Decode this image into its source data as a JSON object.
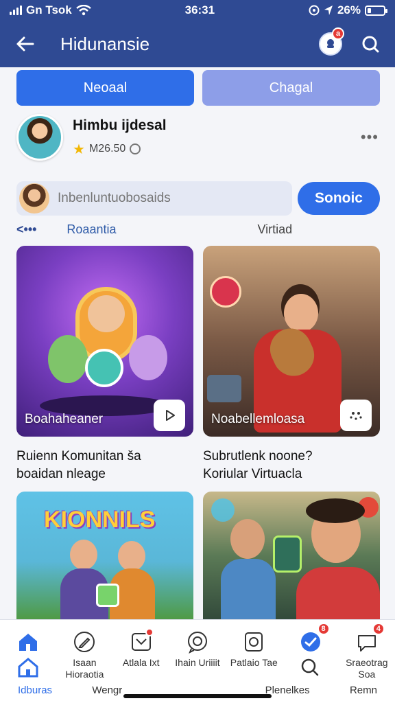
{
  "status": {
    "left_text": "Gn Tsok",
    "time": "36:31",
    "battery": "26%"
  },
  "header": {
    "title": "Hidunansie",
    "notification_count": "a"
  },
  "tabs": [
    {
      "label": "Neoaal"
    },
    {
      "label": "Chagal"
    }
  ],
  "profile": {
    "name": "Himbu ijdesal",
    "meta": "M26.50"
  },
  "composer": {
    "placeholder": "Inbenluntuobosaids",
    "send_label": "Sonoic"
  },
  "subnav": {
    "back": "<•••",
    "left": "Roaantia",
    "right": "Virtiad"
  },
  "cards": [
    {
      "caption": "Boahaheaner",
      "title_line1": "Ruienn Komunitan  ša",
      "title_line2": "boaidan nleage"
    },
    {
      "caption": "Noabellemloasa",
      "title_line1": "Subrutlenk noone?",
      "title_line2": "Koriular Virtuacla"
    },
    {
      "thumb_text": "KIONNILS"
    },
    {
      "caption": ""
    }
  ],
  "bottom_nav": {
    "labels": [
      "Isaan Hioraotia",
      "Atlala Ixt",
      "Ihain Uriiiit",
      "Patlaio Tae",
      "",
      "Sraeotrag Soa"
    ],
    "badges": [
      "8",
      "4"
    ],
    "bottom_row": [
      "Idburas",
      "Wengr",
      "Plenelkes",
      "Remn"
    ]
  },
  "colors": {
    "primary": "#2f4a93",
    "accent": "#2f6ee8",
    "badge": "#e53935"
  }
}
